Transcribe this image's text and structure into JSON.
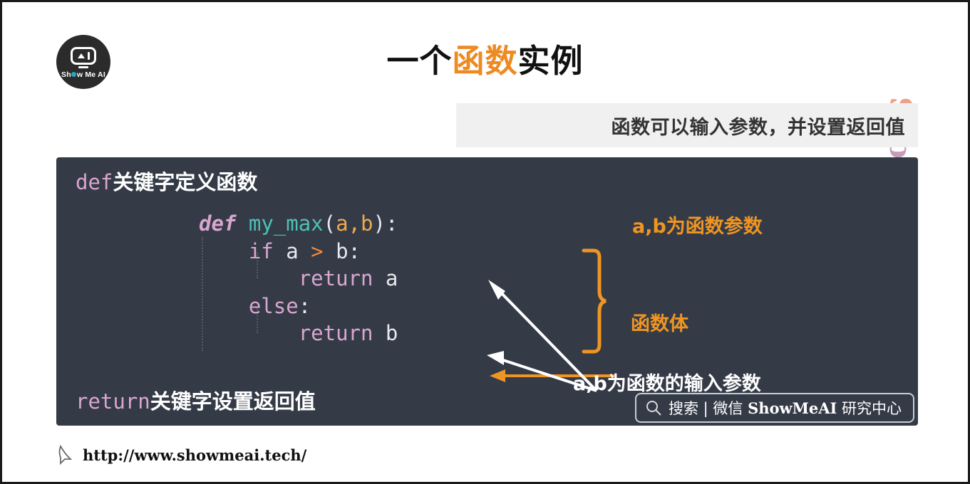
{
  "slide": {
    "title_parts": [
      {
        "text": "一个",
        "accent": false
      },
      {
        "text": "函数",
        "accent": true
      },
      {
        "text": "实例",
        "accent": false
      }
    ],
    "title_plain": "一个函数实例",
    "accent_color": "#ee8a22",
    "background": "#ffffff"
  },
  "logo": {
    "name": "Show Me AI",
    "text_before": "Sh",
    "text_after": "w Me AI",
    "circle_color": "#2b2b2b",
    "dot_color": "#23a6c9"
  },
  "banner": {
    "text": "函数可以输入参数，并设置返回值",
    "background": "#f0f0f0",
    "text_color": "#333333"
  },
  "watermark": {
    "text": "ShowMeAI"
  },
  "code_panel": {
    "background": "#343b47",
    "header": {
      "keyword": "def",
      "rest": "关键字定义函数",
      "keyword_color": "#d9a6d0"
    },
    "footer": {
      "keyword": "return",
      "rest": "关键字设置返回值",
      "keyword_color": "#d9a6d0"
    },
    "code_lines": [
      {
        "indent": 0,
        "tokens": [
          {
            "text": "def",
            "type": "keyword-italic"
          },
          {
            "text": " ",
            "type": "plain"
          },
          {
            "text": "my_max",
            "type": "function"
          },
          {
            "text": "(",
            "type": "plain"
          },
          {
            "text": "a",
            "type": "param"
          },
          {
            "text": ",",
            "type": "param"
          },
          {
            "text": "b",
            "type": "param"
          },
          {
            "text": "):",
            "type": "plain"
          }
        ]
      },
      {
        "indent": 1,
        "tokens": [
          {
            "text": "if",
            "type": "keyword"
          },
          {
            "text": " a ",
            "type": "plain"
          },
          {
            "text": ">",
            "type": "operator"
          },
          {
            "text": " b:",
            "type": "plain"
          }
        ]
      },
      {
        "indent": 2,
        "tokens": [
          {
            "text": "return",
            "type": "keyword"
          },
          {
            "text": " a",
            "type": "plain"
          }
        ]
      },
      {
        "indent": 1,
        "tokens": [
          {
            "text": "else",
            "type": "keyword"
          },
          {
            "text": ":",
            "type": "plain"
          }
        ]
      },
      {
        "indent": 2,
        "tokens": [
          {
            "text": "return",
            "type": "keyword"
          },
          {
            "text": " b",
            "type": "plain"
          }
        ]
      }
    ],
    "code_text": "def my_max(a,b):\n    if a > b:\n        return a\n    else:\n        return b",
    "token_colors": {
      "keyword": "#d9a6d0",
      "function": "#4ec0b4",
      "param": "#f0a94e",
      "operator": "#f0873a",
      "plain": "#e6e9ee"
    }
  },
  "annotations": [
    {
      "id": "params-note",
      "text": "a,b为函数参数",
      "color": "#ef9523",
      "marker": "left-arrow"
    },
    {
      "id": "body-note",
      "text": "函数体",
      "color": "#ef9523",
      "marker": "curly-brace"
    },
    {
      "id": "inputs-note",
      "text": "a,b为函数的输入参数",
      "color": "#ffffff",
      "marker": "two-white-arrows"
    }
  ],
  "search_pill": {
    "label": "搜索 | 微信 ",
    "brand": "ShowMeAI",
    "suffix": " 研究中心",
    "border_color": "#c8ccd4"
  },
  "footer": {
    "url": "http://www.showmeai.tech/"
  }
}
